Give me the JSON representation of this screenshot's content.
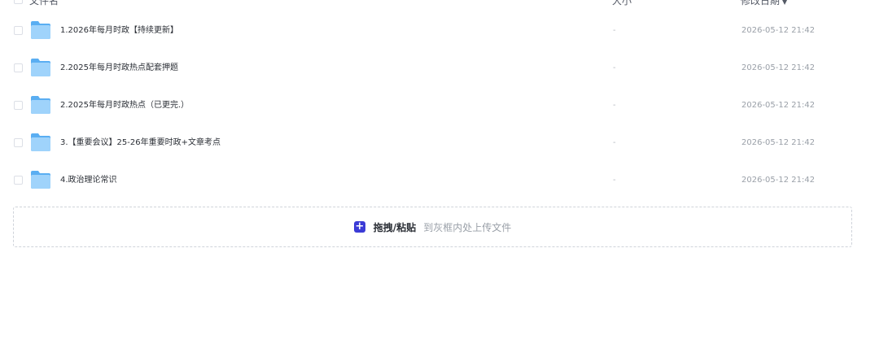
{
  "header": {
    "name_label": "文件名",
    "size_label": "大小",
    "date_label": "修改日期",
    "sort_icon": "caret-down-icon"
  },
  "files": [
    {
      "name": "1.2026年每月时政【持续更新】",
      "size": "-",
      "date": "2026-05-12 21:42"
    },
    {
      "name": "2.2025年每月时政热点配套押题",
      "size": "-",
      "date": "2026-05-12 21:42"
    },
    {
      "name": "2.2025年每月时政热点（已更完.）",
      "size": "-",
      "date": "2026-05-12 21:42"
    },
    {
      "name": "3.【重要会议】25-26年重要时政+文章考点",
      "size": "-",
      "date": "2026-05-12 21:42"
    },
    {
      "name": "4.政治理论常识",
      "size": "-",
      "date": "2026-05-12 21:42"
    }
  ],
  "upload": {
    "action_label": "拖拽/粘贴",
    "hint_label": "到灰框内处上传文件",
    "icon": "plus-square-icon"
  },
  "colors": {
    "accent": "#3b3bd6",
    "folder_light": "#9fd3fb",
    "folder_dark": "#5aaef2"
  }
}
